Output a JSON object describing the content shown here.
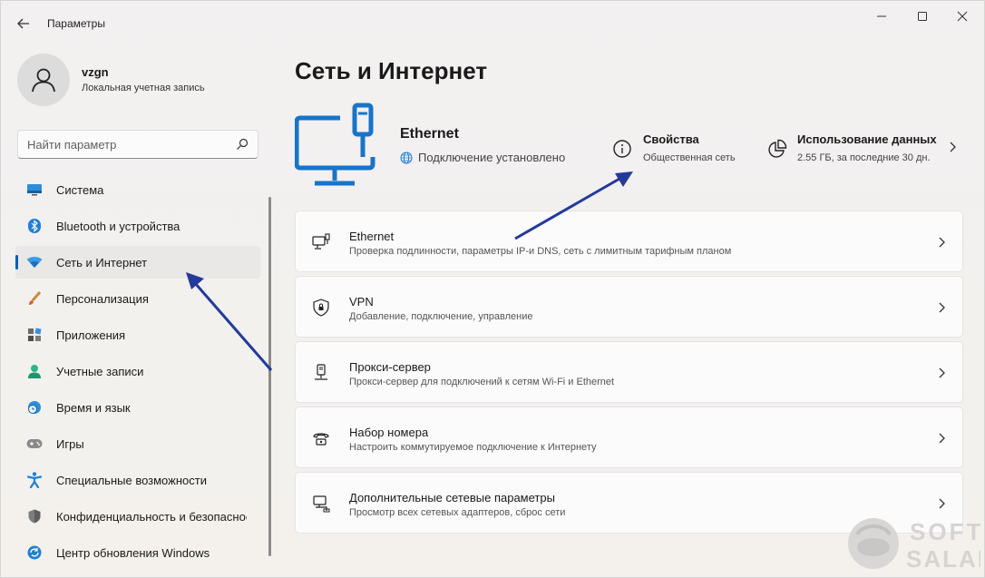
{
  "window": {
    "title": "Параметры"
  },
  "profile": {
    "name": "vzgn",
    "account_type": "Локальная учетная запись"
  },
  "search": {
    "placeholder": "Найти параметр"
  },
  "sidebar": {
    "items": [
      {
        "label": "Система",
        "icon": "system-icon"
      },
      {
        "label": "Bluetooth и устройства",
        "icon": "bluetooth-icon"
      },
      {
        "label": "Сеть и Интернет",
        "icon": "wifi-icon",
        "active": true
      },
      {
        "label": "Персонализация",
        "icon": "brush-icon"
      },
      {
        "label": "Приложения",
        "icon": "apps-icon"
      },
      {
        "label": "Учетные записи",
        "icon": "accounts-icon"
      },
      {
        "label": "Время и язык",
        "icon": "time-language-icon"
      },
      {
        "label": "Игры",
        "icon": "gamepad-icon"
      },
      {
        "label": "Специальные возможности",
        "icon": "accessibility-icon"
      },
      {
        "label": "Конфиденциальность и безопасность",
        "icon": "shield-icon"
      },
      {
        "label": "Центр обновления Windows",
        "icon": "update-icon"
      }
    ]
  },
  "main": {
    "page_title": "Сеть и Интернет",
    "connection": {
      "name": "Ethernet",
      "status": "Подключение установлено"
    },
    "properties": {
      "title": "Свойства",
      "subtitle": "Общественная сеть"
    },
    "data_usage": {
      "title": "Использование данных",
      "subtitle": "2.55 ГБ, за последние 30 дн."
    },
    "cards": [
      {
        "title": "Ethernet",
        "subtitle": "Проверка подлинности, параметры IP-и DNS, сеть с лимитным тарифным планом",
        "icon": "ethernet-icon"
      },
      {
        "title": "VPN",
        "subtitle": "Добавление, подключение, управление",
        "icon": "vpn-shield-icon"
      },
      {
        "title": "Прокси-сервер",
        "subtitle": "Прокси-сервер для подключений к сетям Wi-Fi и Ethernet",
        "icon": "proxy-icon"
      },
      {
        "title": "Набор номера",
        "subtitle": "Настроить коммутируемое подключение к Интернету",
        "icon": "dialup-icon"
      },
      {
        "title": "Дополнительные сетевые параметры",
        "subtitle": "Просмотр всех сетевых адаптеров, сброс сети",
        "icon": "network-adapter-icon"
      }
    ]
  },
  "watermark": {
    "line1": "SOFT",
    "line2": "SALAD"
  },
  "colors": {
    "accent": "#005fb8",
    "arrow": "#23399b",
    "hero_icon": "#1874c9"
  }
}
